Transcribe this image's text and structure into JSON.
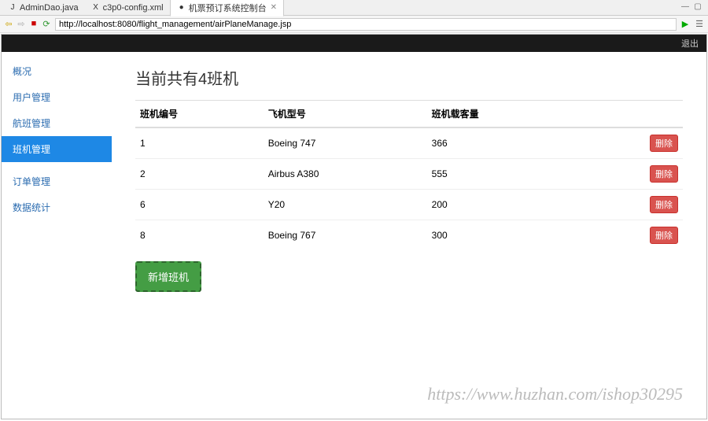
{
  "ide": {
    "tabs": [
      {
        "icon": "J",
        "label": "AdminDao.java"
      },
      {
        "icon": "X",
        "label": "c3p0-config.xml"
      },
      {
        "icon": "●",
        "label": "机票预订系统控制台",
        "active": true,
        "close": "✕"
      }
    ]
  },
  "urlbar": {
    "value": "http://localhost:8080/flight_management/airPlaneManage.jsp"
  },
  "topbar": {
    "logout": "退出"
  },
  "sidebar": {
    "items": [
      {
        "label": "概况"
      },
      {
        "label": "用户管理"
      },
      {
        "label": "航班管理"
      },
      {
        "label": "班机管理",
        "active": true
      },
      {
        "label": "订单管理",
        "sep": true
      },
      {
        "label": "数据统计"
      }
    ]
  },
  "main": {
    "title": "当前共有4班机",
    "columns": [
      "班机编号",
      "飞机型号",
      "班机载客量",
      ""
    ],
    "rows": [
      {
        "id": "1",
        "model": "Boeing 747",
        "cap": "366"
      },
      {
        "id": "2",
        "model": "Airbus A380",
        "cap": "555"
      },
      {
        "id": "6",
        "model": "Y20",
        "cap": "200"
      },
      {
        "id": "8",
        "model": "Boeing 767",
        "cap": "300"
      }
    ],
    "delete_label": "删除",
    "add_label": "新增班机"
  },
  "watermark": "https://www.huzhan.com/ishop30295"
}
